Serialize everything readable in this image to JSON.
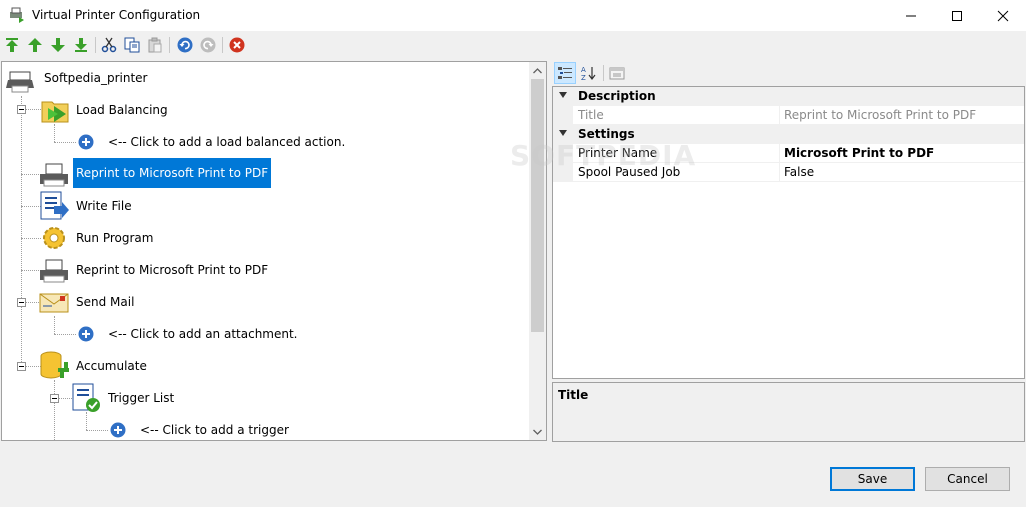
{
  "window": {
    "title": "Virtual Printer Configuration"
  },
  "tree": {
    "root": "Softpedia_printer",
    "nodes": [
      {
        "label": "Load Balancing",
        "icon": "load-balancing-icon"
      },
      {
        "label": "<-- Click to add a load balanced action.",
        "icon": "add-icon"
      },
      {
        "label": "Reprint to Microsoft Print to PDF",
        "icon": "printer-icon",
        "selected": true
      },
      {
        "label": "Write File",
        "icon": "write-file-icon"
      },
      {
        "label": "Run Program",
        "icon": "gear-icon"
      },
      {
        "label": "Reprint to Microsoft Print to PDF",
        "icon": "printer-icon"
      },
      {
        "label": "Send Mail",
        "icon": "envelope-icon"
      },
      {
        "label": "<-- Click to add an attachment.",
        "icon": "add-icon"
      },
      {
        "label": "Accumulate",
        "icon": "database-add-icon"
      },
      {
        "label": "Trigger List",
        "icon": "trigger-list-icon"
      },
      {
        "label": "<-- Click to add a trigger",
        "icon": "add-icon"
      }
    ]
  },
  "properties": {
    "categories": [
      {
        "name": "Description",
        "rows": [
          {
            "name": "Title",
            "value": "Reprint to Microsoft Print to PDF",
            "disabled": true
          }
        ]
      },
      {
        "name": "Settings",
        "rows": [
          {
            "name": "Printer Name",
            "value": "Microsoft Print to PDF",
            "bold": true
          },
          {
            "name": "Spool Paused Job",
            "value": "False"
          }
        ]
      }
    ],
    "help_title": "Title"
  },
  "buttons": {
    "save": "Save",
    "cancel": "Cancel"
  },
  "watermark": "SOFTPEDIA",
  "colors": {
    "selection": "#0078d7",
    "toolbar_green": "#3aa02a",
    "delete_red": "#d0341f"
  }
}
